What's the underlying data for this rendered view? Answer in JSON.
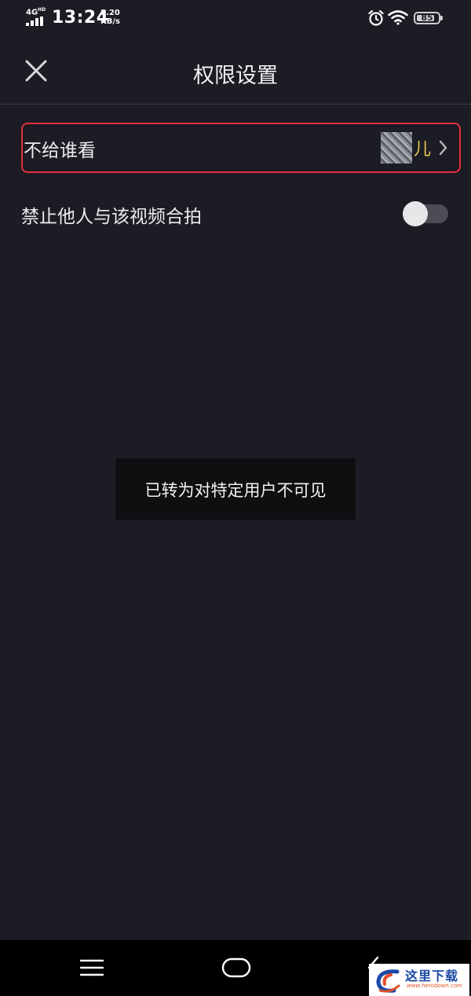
{
  "status_bar": {
    "network": "4G",
    "network_sup": "HD",
    "time": "13:24",
    "speed_value": "2.20",
    "speed_unit": "KB/s",
    "battery": "85",
    "battery_level": 0.85
  },
  "header": {
    "title": "权限设置",
    "close_icon": "close-icon"
  },
  "settings": {
    "hide_from": {
      "label": "不给谁看",
      "user_name": "儿",
      "highlight_color": "#e1303e",
      "name_color": "#e8c35a"
    },
    "disable_duet": {
      "label": "禁止他人与该视频合拍",
      "enabled": false
    }
  },
  "toast": {
    "message": "已转为对特定用户不可见"
  },
  "system_nav": {
    "menu_icon": "menu-icon",
    "home_icon": "home-icon",
    "back_icon": "back-icon"
  },
  "watermark": {
    "title": "这里下载",
    "url": "www.herodown.com"
  },
  "colors": {
    "background": "#1b1c24",
    "divider": "#3a3b44",
    "toast_bg": "#0f0f12"
  }
}
